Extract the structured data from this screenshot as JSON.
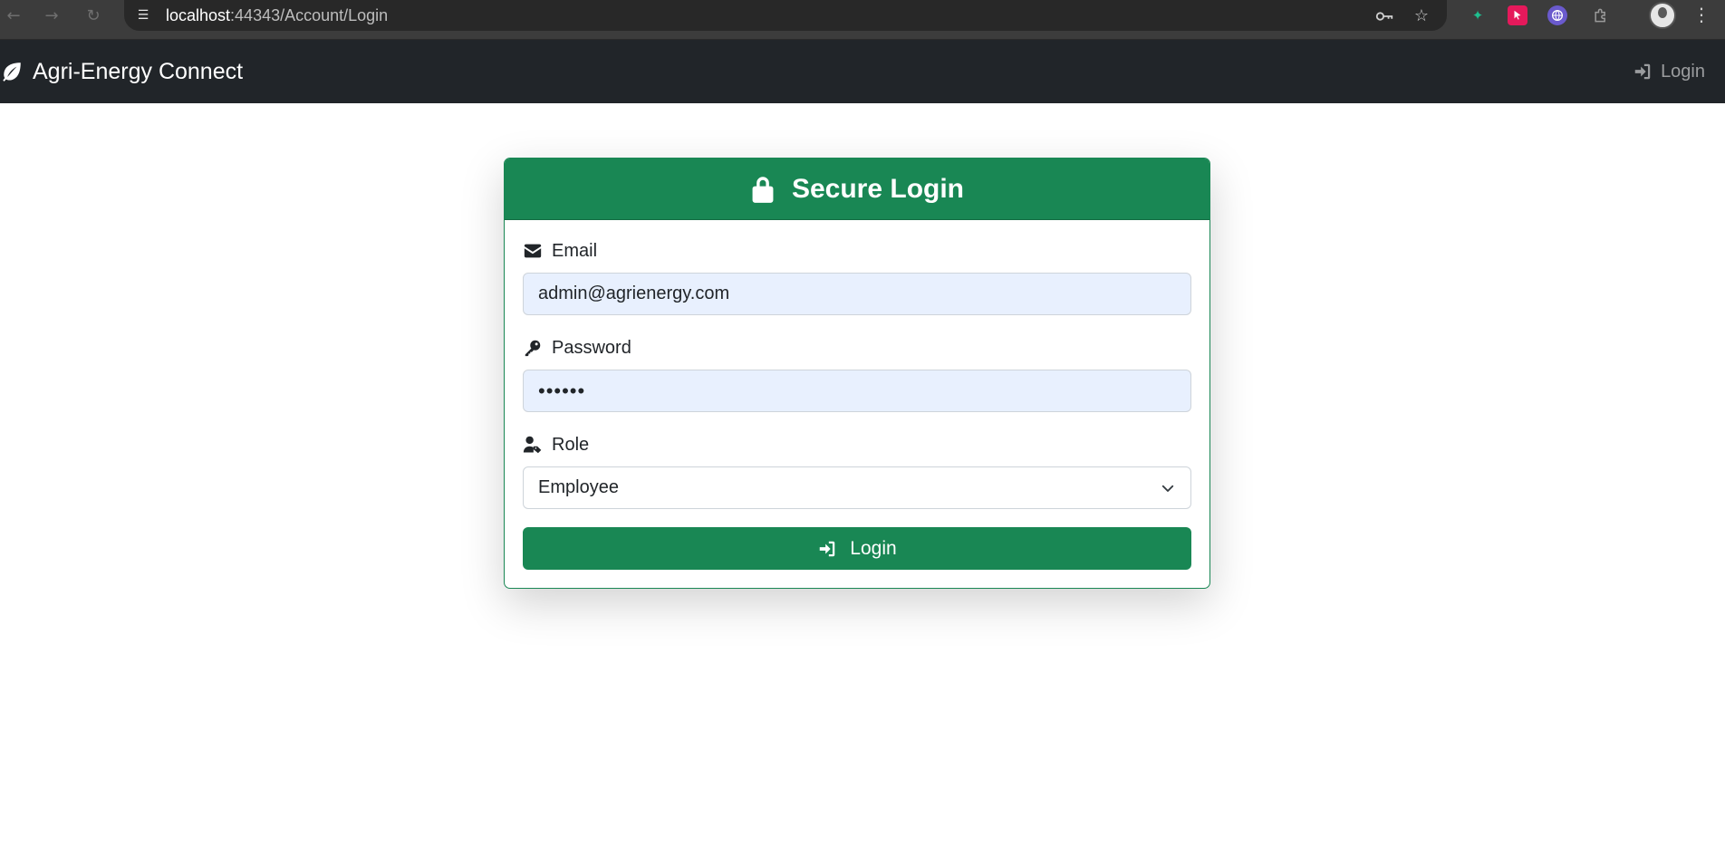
{
  "browser": {
    "url_host": "localhost",
    "url_path": ":44343/Account/Login"
  },
  "navbar": {
    "brand": "Agri-Energy Connect",
    "login_link": "Login"
  },
  "login_card": {
    "title": "Secure Login",
    "email_label": "Email",
    "email_value": "admin@agrienergy.com",
    "password_label": "Password",
    "password_value": "••••••",
    "role_label": "Role",
    "role_selected": "Employee",
    "submit_label": "Login"
  },
  "colors": {
    "accent": "#198754",
    "navbar_bg": "#212529",
    "autofill_bg": "#e8f0fe"
  },
  "icons": {
    "brand": "leaf-icon",
    "nav_login": "sign-in-icon",
    "title": "lock-icon",
    "email": "envelope-icon",
    "password": "key-icon",
    "role": "user-tag-icon",
    "select": "chevron-down-icon",
    "submit": "sign-in-icon"
  }
}
